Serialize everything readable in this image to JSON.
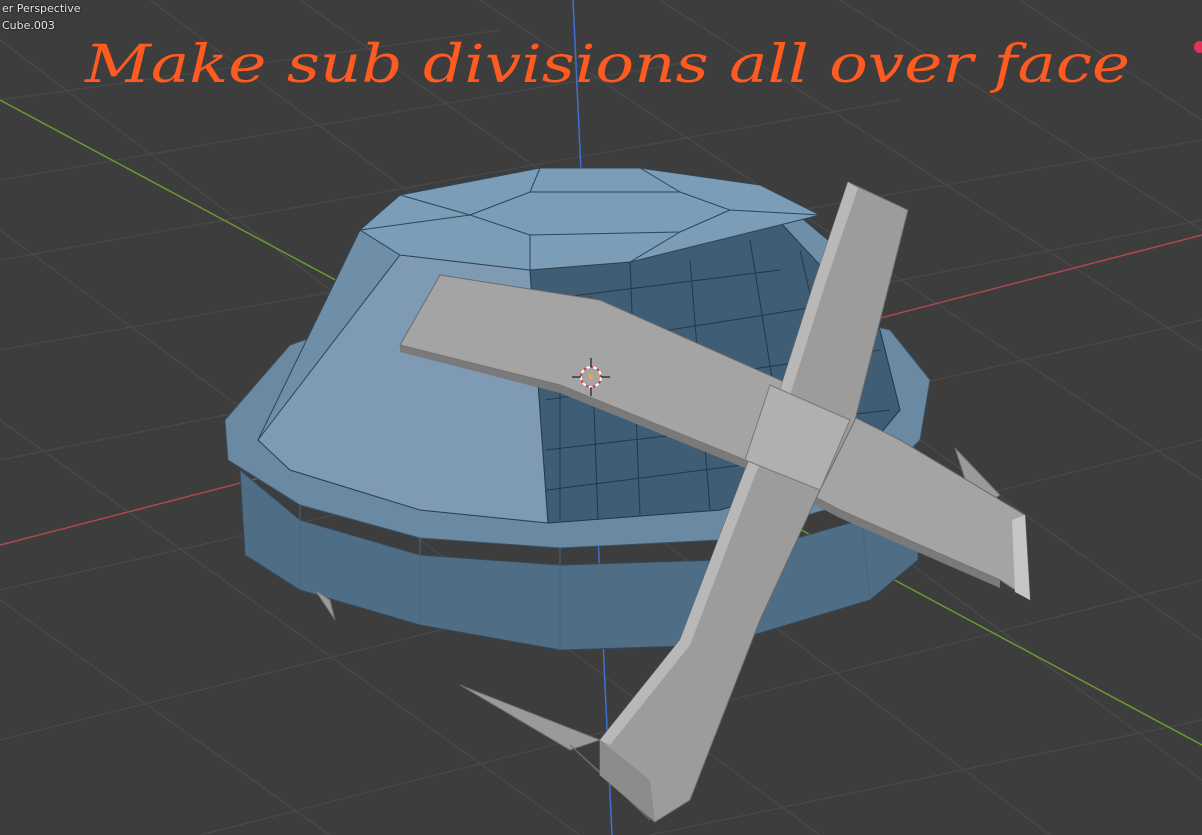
{
  "viewport": {
    "view_label": "er Perspective",
    "object_label": "Cube.003"
  },
  "annotation": {
    "text": "Make sub divisions all over face",
    "color": "#ff5a1f"
  },
  "colors": {
    "background": "#3d3d3d",
    "grid": "#4a4a4a",
    "x_axis": "#b24651",
    "y_axis": "#6b9a2f",
    "z_axis": "#3f6fd1",
    "mesh_blue_light": "#7a9ab4",
    "mesh_blue_mid": "#5f7d97",
    "mesh_blue_dark": "#3d5b72",
    "plank_gray": "#a3a3a3"
  },
  "icons": [
    "3d-cursor-icon"
  ]
}
